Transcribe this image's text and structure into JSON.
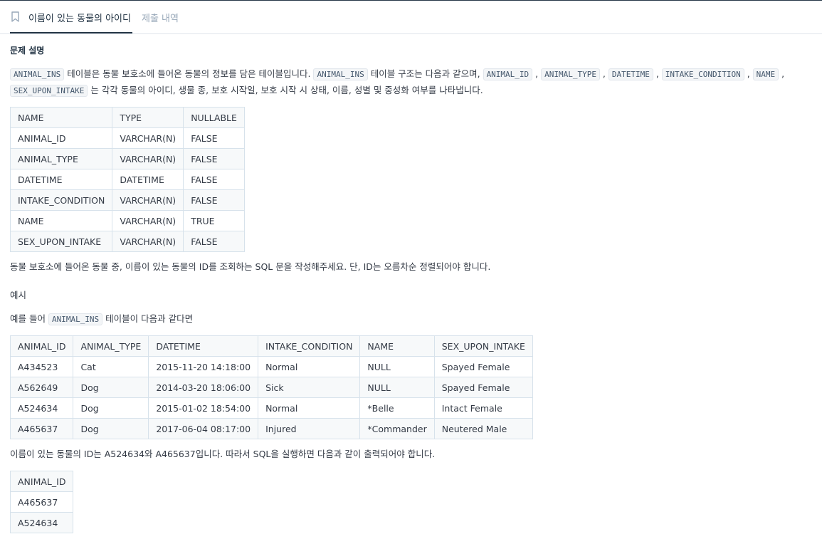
{
  "tabs": {
    "active": "이름이 있는 동물의 아이디",
    "other": "제출 내역"
  },
  "section_title": "문제 설명",
  "intro": {
    "code1": "ANIMAL_INS",
    "t1": " 테이블은 동물 보호소에 들어온 동물의 정보를 담은 테이블입니다. ",
    "code2": "ANIMAL_INS",
    "t2": " 테이블 구조는 다음과 같으며, ",
    "c3": "ANIMAL_ID",
    "c4": "ANIMAL_TYPE",
    "c5": "DATETIME",
    "c6": "INTAKE_CONDITION",
    "c7": "NAME",
    "c8": "SEX_UPON_INTAKE",
    "sep": " , ",
    "t3": " 는 각각 동물의 아이디, 생물 종, 보호 시작일, 보호 시작 시 상태, 이름, 성별 및 중성화 여부를 나타냅니다."
  },
  "schema_table": {
    "header": [
      "NAME",
      "TYPE",
      "NULLABLE"
    ],
    "rows": [
      [
        "ANIMAL_ID",
        "VARCHAR(N)",
        "FALSE"
      ],
      [
        "ANIMAL_TYPE",
        "VARCHAR(N)",
        "FALSE"
      ],
      [
        "DATETIME",
        "DATETIME",
        "FALSE"
      ],
      [
        "INTAKE_CONDITION",
        "VARCHAR(N)",
        "FALSE"
      ],
      [
        "NAME",
        "VARCHAR(N)",
        "TRUE"
      ],
      [
        "SEX_UPON_INTAKE",
        "VARCHAR(N)",
        "FALSE"
      ]
    ]
  },
  "question": "동물 보호소에 들어온 동물 중, 이름이 있는 동물의 ID를 조회하는 SQL 문을 작성해주세요. 단, ID는 오름차순 정렬되어야 합니다.",
  "example_title": "예시",
  "example_intro": {
    "t1": "예를 들어 ",
    "code": "ANIMAL_INS",
    "t2": " 테이블이 다음과 같다면"
  },
  "example_table": {
    "header": [
      "ANIMAL_ID",
      "ANIMAL_TYPE",
      "DATETIME",
      "INTAKE_CONDITION",
      "NAME",
      "SEX_UPON_INTAKE"
    ],
    "rows": [
      [
        "A434523",
        "Cat",
        "2015-11-20 14:18:00",
        "Normal",
        "NULL",
        "Spayed Female"
      ],
      [
        "A562649",
        "Dog",
        "2014-03-20 18:06:00",
        "Sick",
        "NULL",
        "Spayed Female"
      ],
      [
        "A524634",
        "Dog",
        "2015-01-02 18:54:00",
        "Normal",
        "*Belle",
        "Intact Female"
      ],
      [
        "A465637",
        "Dog",
        "2017-06-04 08:17:00",
        "Injured",
        "*Commander",
        "Neutered Male"
      ]
    ]
  },
  "result_text": "이름이 있는 동물의 ID는 A524634와 A465637입니다. 따라서 SQL을 실행하면 다음과 같이 출력되어야 합니다.",
  "result_table": {
    "header": [
      "ANIMAL_ID"
    ],
    "rows": [
      [
        "A465637"
      ],
      [
        "A524634"
      ]
    ]
  },
  "colors": {
    "border": "#d7e2eb",
    "stripe": "#f7f9fa",
    "tab_active": "#263747",
    "tab_inactive": "#98a8b9"
  },
  "icons": {
    "tab": "bookmark-icon"
  }
}
